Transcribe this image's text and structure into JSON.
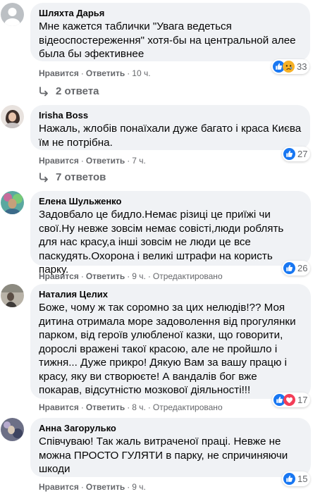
{
  "actions": {
    "like": "Нравится",
    "reply": "Ответить",
    "separator": "·",
    "edited": "Отредактировано"
  },
  "colors": {
    "bubble": "#f0f2f5",
    "meta": "#65676b",
    "like_blue": "#1877f2",
    "sad_yellow": "#f7b125",
    "love_red": "#f33e58"
  },
  "comments": [
    {
      "author": "Шляхта Дарья",
      "text": "Мне кажется таблички \"Увага ведеться відеоспостереження\" хотя-бы на центральной алее была бы эфективнее",
      "time": "10 ч.",
      "reactions": [
        "like-icon",
        "sad-icon"
      ],
      "reaction_count": "33",
      "replies_label": "2 ответа"
    },
    {
      "author": "Irisha Boss",
      "text": "Нажаль, жлобів понаїхали дуже багато і краса Києва їм не потрібна.",
      "time": "7 ч.",
      "reactions": [
        "like-icon"
      ],
      "reaction_count": "27",
      "replies_label": "7 ответов"
    },
    {
      "author": "Елена Шульженко",
      "text": "Задовбало це бидло.Немає різиці це приїжі чи свої.Ну невже зовсім немає совісті,люди роблять для нас красу,а інші зовсім не люди це все паскудять.Охорона і великі штрафи на користь парку.",
      "time": "9 ч.",
      "edited": true,
      "reactions": [
        "like-icon"
      ],
      "reaction_count": "26"
    },
    {
      "author": "Наталия Целих",
      "text": "Боже, чому ж так соромно за цих нелюдів!?? Моя дитина отримала море задоволення від прогулянки парком, від героїв улюбленої казки, що говорити, дорослі вражені такої красою, але не пройшло і тижня... Дуже прикро! Дякую Вам за вашу працю і красу, яку ви створюєте! А вандалів бог вже покарав, відсутністю мозкової діяльності!!!",
      "time": "8 ч.",
      "edited": true,
      "reactions": [
        "like-icon",
        "love-icon"
      ],
      "reaction_count": "17"
    },
    {
      "author": "Анна Загорулько",
      "text": "Співчуваю! Так жаль витраченої праці. Невже не можна ПРОСТО ГУЛЯТИ в парку, не спричиняючи шкоди",
      "time": "9 ч.",
      "reactions": [
        "like-icon"
      ],
      "reaction_count": "15"
    }
  ]
}
